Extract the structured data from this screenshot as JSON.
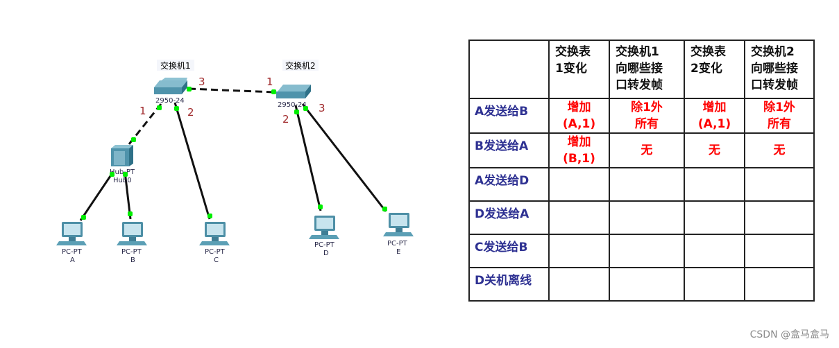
{
  "topology": {
    "switches": [
      {
        "id": "sw1",
        "name": "交换机1",
        "model": "2950-24"
      },
      {
        "id": "sw2",
        "name": "交换机2",
        "model": "2950-24"
      }
    ],
    "hub": {
      "model": "Hub-PT",
      "name": "Hub0"
    },
    "pcs": [
      {
        "id": "A",
        "model": "PC-PT",
        "name": "A"
      },
      {
        "id": "B",
        "model": "PC-PT",
        "name": "B"
      },
      {
        "id": "C",
        "model": "PC-PT",
        "name": "C"
      },
      {
        "id": "D",
        "model": "PC-PT",
        "name": "D"
      },
      {
        "id": "E",
        "model": "PC-PT",
        "name": "E"
      }
    ],
    "port_labels": {
      "sw1_p1": "1",
      "sw1_p2": "2",
      "sw1_p3": "3",
      "sw2_p1": "1",
      "sw2_p2": "2",
      "sw2_p3": "3"
    },
    "colors": {
      "port_dot": "#00ee00",
      "port_label": "#a0282a",
      "device": "#5b9fb5"
    }
  },
  "table": {
    "headers": [
      "",
      "交换表\n1变化",
      "交换机1\n向哪些接\n口转发帧",
      "交换表\n2变化",
      "交换机2\n向哪些接\n口转发帧"
    ],
    "rows": [
      {
        "label": "A发送给B",
        "cells": [
          "增加\n(A,1)",
          "除1外\n所有",
          "增加\n(A,1)",
          "除1外\n所有"
        ]
      },
      {
        "label": "B发送给A",
        "cells": [
          "增加\n(B,1)",
          "无",
          "无",
          "无"
        ]
      },
      {
        "label": "A发送给D",
        "cells": [
          "",
          "",
          "",
          ""
        ]
      },
      {
        "label": "D发送给A",
        "cells": [
          "",
          "",
          "",
          ""
        ]
      },
      {
        "label": "C发送给B",
        "cells": [
          "",
          "",
          "",
          ""
        ]
      },
      {
        "label": "D关机离线",
        "cells": [
          "",
          "",
          "",
          ""
        ]
      }
    ],
    "colors": {
      "row_label": "#2e3192",
      "value": "#ff0000",
      "header": "#111111"
    }
  },
  "watermark": "CSDN @盒马盒马"
}
